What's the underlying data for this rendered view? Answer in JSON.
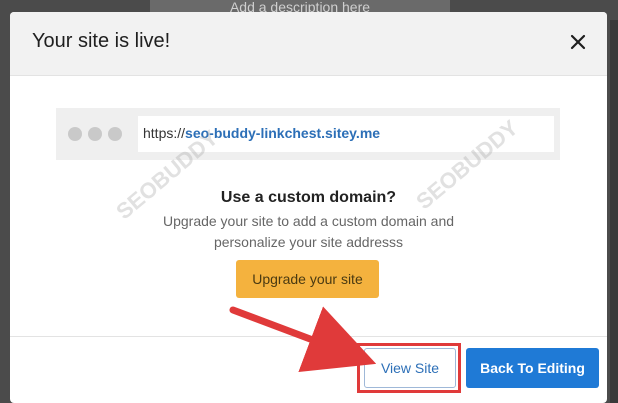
{
  "background": {
    "partial_text": "Add a description here"
  },
  "modal": {
    "title": "Your site is live!",
    "close_icon": "close-icon",
    "url": {
      "prefix": "https://",
      "domain": "seo-buddy-linkchest.sitey.me"
    },
    "promo": {
      "heading": "Use a custom domain?",
      "line1": "Upgrade your site to add a custom domain and",
      "line2": "personalize your site addresss",
      "button": "Upgrade your site"
    },
    "footer": {
      "view_site": "View Site",
      "back_to_editing": "Back To Editing"
    }
  },
  "watermark": {
    "text": "SEOBUDDY"
  },
  "colors": {
    "primary_button": "#1f7ad6",
    "upgrade_button": "#f4b23e",
    "highlight": "#e03a3a",
    "link": "#2c6fb7"
  }
}
